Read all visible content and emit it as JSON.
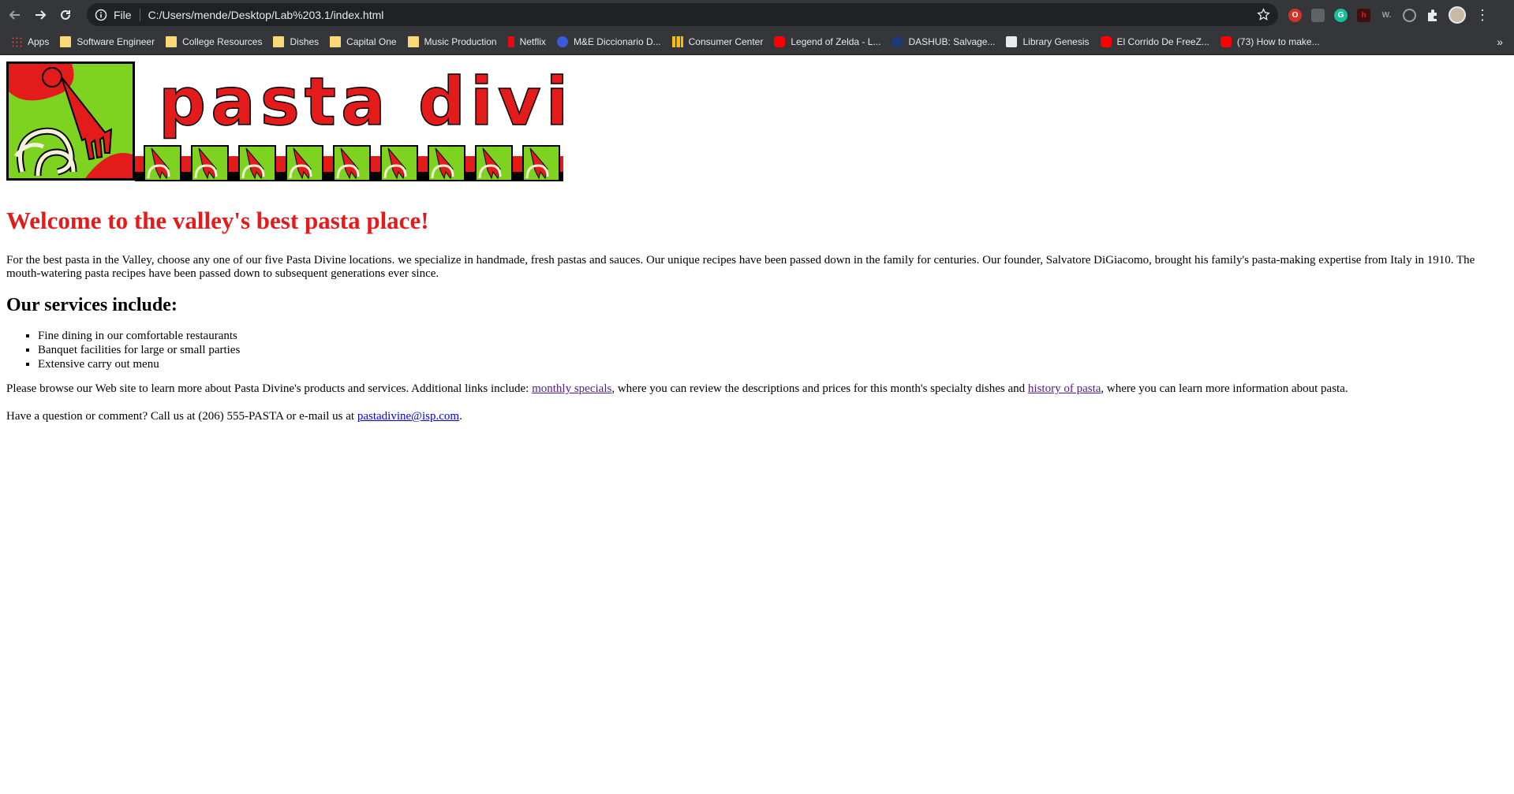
{
  "browser": {
    "scheme_label": "File",
    "url": "C:/Users/mende/Desktop/Lab%203.1/index.html",
    "bookmarks": [
      {
        "label": "Apps",
        "icon": "apps-grid-icon"
      },
      {
        "label": "Software Engineer",
        "icon": "folder-icon"
      },
      {
        "label": "College Resources",
        "icon": "folder-icon"
      },
      {
        "label": "Dishes",
        "icon": "folder-icon"
      },
      {
        "label": "Capital One",
        "icon": "folder-icon"
      },
      {
        "label": "Music Production",
        "icon": "folder-icon"
      },
      {
        "label": "Netflix",
        "icon": "netflix-icon"
      },
      {
        "label": "M&E Diccionario D...",
        "icon": "globe-icon"
      },
      {
        "label": "Consumer Center",
        "icon": "bars-icon"
      },
      {
        "label": "Legend of Zelda - L...",
        "icon": "youtube-icon"
      },
      {
        "label": "DASHUB: Salvage...",
        "icon": "circle-icon"
      },
      {
        "label": "Library Genesis",
        "icon": "library-icon"
      },
      {
        "label": "El Corrido De FreeZ...",
        "icon": "youtube-icon"
      },
      {
        "label": "(73) How to make...",
        "icon": "youtube-icon"
      }
    ],
    "bookmarks_overflow": "»"
  },
  "logo": {
    "text": "pasta divine",
    "colors": {
      "red": "#e31b1b",
      "green": "#7ed321",
      "cream": "#f5f0d8"
    }
  },
  "page": {
    "heading": "Welcome to the valley's best pasta place!",
    "intro": "For the best pasta in the Valley, choose any one of our five Pasta Divine locations. we specialize in handmade, fresh pastas and sauces. Our unique recipes have been passed down in the family for centuries. Our founder, Salvatore DiGiacomo, brought his family's pasta-making expertise from Italy in 1910. The mouth-watering pasta recipes have been passed down to subsequent generations ever since.",
    "services_heading": "Our services include:",
    "services": [
      "Fine dining in our comfortable restaurants",
      "Banquet facilities for large or small parties",
      "Extensive carry out menu"
    ],
    "browse_1": "Please browse our Web site to learn more about Pasta Divine's products and services. Additional links include: ",
    "link_specials": "monthly specials",
    "browse_2": ", where you can review the descriptions and prices for this month's specialty dishes and ",
    "link_history": "history of pasta",
    "browse_3": ", where you can learn more information about pasta.",
    "contact_1": "Have a question or comment? Call us at (206) 555-PASTA or e-mail us at ",
    "email": "pastadivine@isp.com",
    "contact_2": "."
  }
}
